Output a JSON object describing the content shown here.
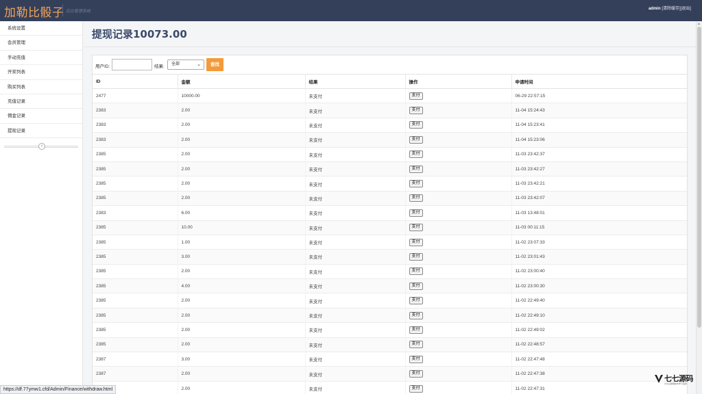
{
  "header": {
    "brand": "加勒比骰子",
    "subtitle": "后台管理系统",
    "user": "admin",
    "clear_cache": "[清除缓存]",
    "logout": "[退出]"
  },
  "sidebar": {
    "items": [
      "系统设置",
      "会员管理",
      "手动充值",
      "开奖列表",
      "购买列表",
      "充值记录",
      "佣金记录",
      "提现记录"
    ],
    "collapse_icon": "‹"
  },
  "page": {
    "title": "提现记录10073.00"
  },
  "filter": {
    "user_id_label": "用户ID:",
    "user_id_value": "",
    "result_label": "结果:",
    "result_selected": "全部",
    "search_button": "查找"
  },
  "table": {
    "headers": [
      "ID",
      "金额",
      "结果",
      "操作",
      "申请时间"
    ],
    "action_label": "支付",
    "rows": [
      {
        "id": "2477",
        "amount": "10000.00",
        "result": "未支付",
        "time": "06-29 22:57:15"
      },
      {
        "id": "2383",
        "amount": "2.00",
        "result": "未支付",
        "time": "11-04 15:24:43"
      },
      {
        "id": "2383",
        "amount": "2.00",
        "result": "未支付",
        "time": "11-04 15:23:41"
      },
      {
        "id": "2383",
        "amount": "2.00",
        "result": "未支付",
        "time": "11-04 15:23:06"
      },
      {
        "id": "2385",
        "amount": "2.00",
        "result": "未支付",
        "time": "11-03 23:42:37"
      },
      {
        "id": "2385",
        "amount": "2.00",
        "result": "未支付",
        "time": "11-03 23:42:27"
      },
      {
        "id": "2385",
        "amount": "2.00",
        "result": "未支付",
        "time": "11-03 23:42:21"
      },
      {
        "id": "2385",
        "amount": "2.00",
        "result": "未支付",
        "time": "11-03 23:42:07"
      },
      {
        "id": "2383",
        "amount": "6.00",
        "result": "未支付",
        "time": "11-03 13:48:01"
      },
      {
        "id": "2385",
        "amount": "10.00",
        "result": "未支付",
        "time": "11-03 00:11:15"
      },
      {
        "id": "2385",
        "amount": "1.00",
        "result": "未支付",
        "time": "11-02 23:07:33"
      },
      {
        "id": "2385",
        "amount": "3.00",
        "result": "未支付",
        "time": "11-02 23:01:43"
      },
      {
        "id": "2385",
        "amount": "2.00",
        "result": "未支付",
        "time": "11-02 23:00:40"
      },
      {
        "id": "2385",
        "amount": "4.00",
        "result": "未支付",
        "time": "11-02 23:00:30"
      },
      {
        "id": "2385",
        "amount": "2.00",
        "result": "未支付",
        "time": "11-02 22:49:40"
      },
      {
        "id": "2385",
        "amount": "2.00",
        "result": "未支付",
        "time": "11-02 22:49:10"
      },
      {
        "id": "2385",
        "amount": "2.00",
        "result": "未支付",
        "time": "11-02 22:49:02"
      },
      {
        "id": "2385",
        "amount": "2.00",
        "result": "未支付",
        "time": "11-02 22:48:57"
      },
      {
        "id": "2387",
        "amount": "3.00",
        "result": "未支付",
        "time": "11-02 22:47:48"
      },
      {
        "id": "2387",
        "amount": "2.00",
        "result": "未支付",
        "time": "11-02 22:47:38"
      },
      {
        "id": "",
        "amount": "2.00",
        "result": "未支付",
        "time": "11-02 22:47:31"
      }
    ]
  },
  "statusbar": {
    "url": "https://df.77ymw1.cfd/Admin/Finance/withdraw.html"
  },
  "watermark": {
    "text": "七七源码",
    "sub": "分享互联网技术学习宝库",
    "logo_icon": "v-logo-icon"
  },
  "colors": {
    "header_bg": "#34405a",
    "brand": "#f0a35a",
    "accent_button": "#f49a3a",
    "title": "#3a4a6a"
  }
}
